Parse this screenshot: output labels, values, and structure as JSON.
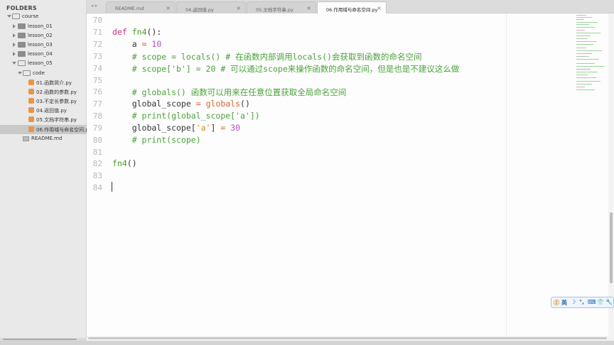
{
  "sidebar": {
    "title": "FOLDERS",
    "root": "course",
    "folders": [
      "lesson_01",
      "lesson_02",
      "lesson_03",
      "lesson_04",
      "lesson_05"
    ],
    "code_folder": "code",
    "files": [
      "01.函数简介.py",
      "02.函数的参数.py",
      "03.不定长参数.py",
      "04.返回值.py",
      "05.文档字符串.py",
      "06.作用域与命名空间.py"
    ],
    "readme": "README.md"
  },
  "tabs": [
    {
      "label": "README.md",
      "close": "×"
    },
    {
      "label": "04.返回值.py",
      "close": "×"
    },
    {
      "label": "05.文档字符串.py",
      "close": "×"
    },
    {
      "label": "06.作用域与命名空间.py",
      "close": "×"
    }
  ],
  "tab_nav": "◂ ▸",
  "editor": {
    "line_numbers": [
      "70",
      "71",
      "72",
      "73",
      "74",
      "75",
      "76",
      "77",
      "78",
      "79",
      "80",
      "81",
      "82",
      "83",
      "84"
    ],
    "l71_def": "def",
    "l71_name": "fn4",
    "l71_rest": "():",
    "l72_var": "    a ",
    "l72_op": "=",
    "l72_num": " 10",
    "l73": "    # scope = locals() # 在函数内部调用locals()会获取到函数的命名空间",
    "l74": "    # scope['b'] = 20 # 可以通过scope来操作函数的命名空间，但是也是不建议这么做",
    "l76": "    # globals() 函数可以用来在任意位置获取全局命名空间",
    "l77_var": "    global_scope ",
    "l77_op": "=",
    "l77_fn": " globals",
    "l77_rest": "()",
    "l78": "    # print(global_scope['a'])",
    "l79_var": "    global_scope[",
    "l79_str": "'a'",
    "l79_mid": "] ",
    "l79_op": "=",
    "l79_num": " 30",
    "l80": "    # print(scope)",
    "l82_name": "fn4",
    "l82_rest": "()"
  },
  "ime": {
    "lang": "英",
    "items": [
      "☽",
      "°,",
      "⌨",
      "👕",
      "🔧"
    ]
  },
  "colors": {
    "keyword": "#c8317b",
    "function": "#4a9c2b",
    "number": "#b54cd0",
    "comment": "#4aa23a",
    "operator": "#d9622f"
  }
}
